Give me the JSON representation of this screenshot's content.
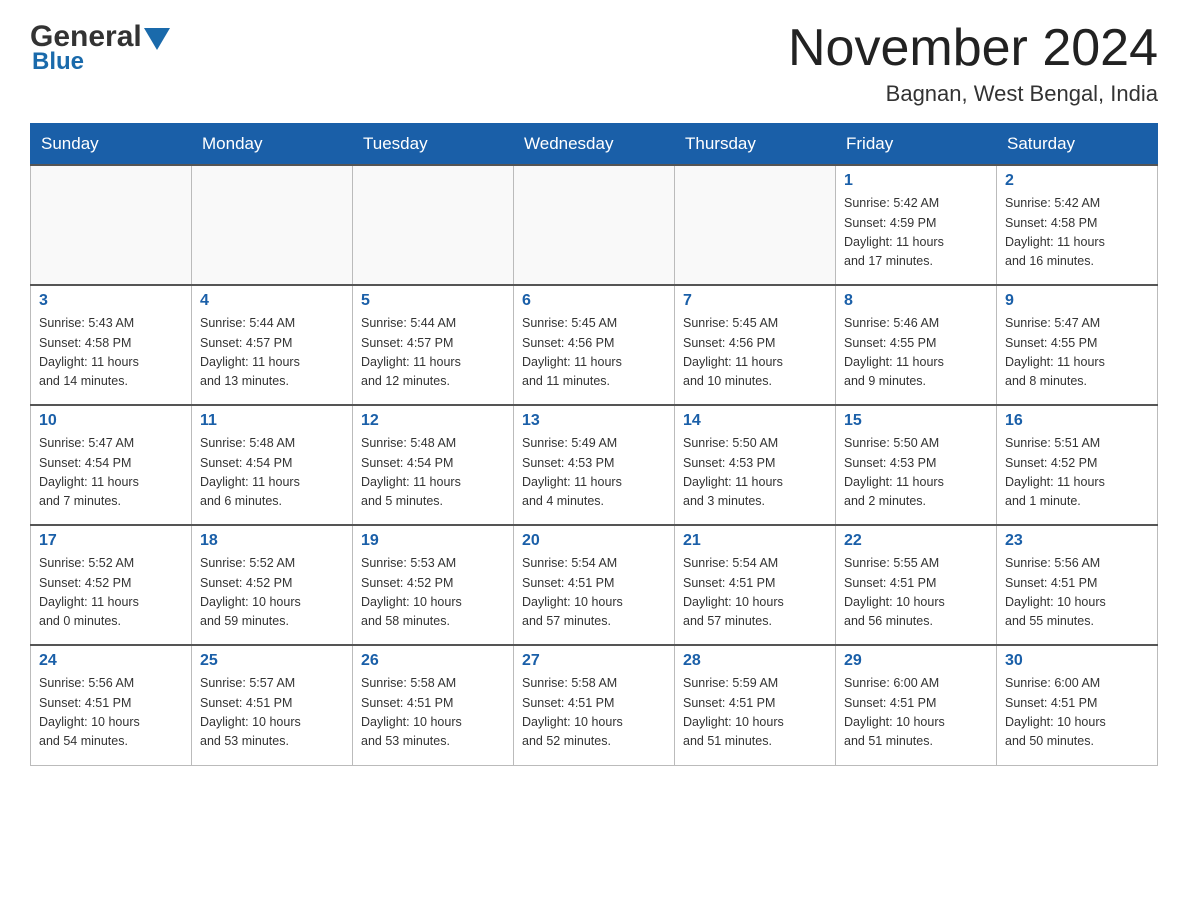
{
  "header": {
    "logo_general": "General",
    "logo_blue": "Blue",
    "month_title": "November 2024",
    "location": "Bagnan, West Bengal, India"
  },
  "weekdays": [
    "Sunday",
    "Monday",
    "Tuesday",
    "Wednesday",
    "Thursday",
    "Friday",
    "Saturday"
  ],
  "weeks": [
    {
      "days": [
        {
          "number": "",
          "info": ""
        },
        {
          "number": "",
          "info": ""
        },
        {
          "number": "",
          "info": ""
        },
        {
          "number": "",
          "info": ""
        },
        {
          "number": "",
          "info": ""
        },
        {
          "number": "1",
          "info": "Sunrise: 5:42 AM\nSunset: 4:59 PM\nDaylight: 11 hours\nand 17 minutes."
        },
        {
          "number": "2",
          "info": "Sunrise: 5:42 AM\nSunset: 4:58 PM\nDaylight: 11 hours\nand 16 minutes."
        }
      ]
    },
    {
      "days": [
        {
          "number": "3",
          "info": "Sunrise: 5:43 AM\nSunset: 4:58 PM\nDaylight: 11 hours\nand 14 minutes."
        },
        {
          "number": "4",
          "info": "Sunrise: 5:44 AM\nSunset: 4:57 PM\nDaylight: 11 hours\nand 13 minutes."
        },
        {
          "number": "5",
          "info": "Sunrise: 5:44 AM\nSunset: 4:57 PM\nDaylight: 11 hours\nand 12 minutes."
        },
        {
          "number": "6",
          "info": "Sunrise: 5:45 AM\nSunset: 4:56 PM\nDaylight: 11 hours\nand 11 minutes."
        },
        {
          "number": "7",
          "info": "Sunrise: 5:45 AM\nSunset: 4:56 PM\nDaylight: 11 hours\nand 10 minutes."
        },
        {
          "number": "8",
          "info": "Sunrise: 5:46 AM\nSunset: 4:55 PM\nDaylight: 11 hours\nand 9 minutes."
        },
        {
          "number": "9",
          "info": "Sunrise: 5:47 AM\nSunset: 4:55 PM\nDaylight: 11 hours\nand 8 minutes."
        }
      ]
    },
    {
      "days": [
        {
          "number": "10",
          "info": "Sunrise: 5:47 AM\nSunset: 4:54 PM\nDaylight: 11 hours\nand 7 minutes."
        },
        {
          "number": "11",
          "info": "Sunrise: 5:48 AM\nSunset: 4:54 PM\nDaylight: 11 hours\nand 6 minutes."
        },
        {
          "number": "12",
          "info": "Sunrise: 5:48 AM\nSunset: 4:54 PM\nDaylight: 11 hours\nand 5 minutes."
        },
        {
          "number": "13",
          "info": "Sunrise: 5:49 AM\nSunset: 4:53 PM\nDaylight: 11 hours\nand 4 minutes."
        },
        {
          "number": "14",
          "info": "Sunrise: 5:50 AM\nSunset: 4:53 PM\nDaylight: 11 hours\nand 3 minutes."
        },
        {
          "number": "15",
          "info": "Sunrise: 5:50 AM\nSunset: 4:53 PM\nDaylight: 11 hours\nand 2 minutes."
        },
        {
          "number": "16",
          "info": "Sunrise: 5:51 AM\nSunset: 4:52 PM\nDaylight: 11 hours\nand 1 minute."
        }
      ]
    },
    {
      "days": [
        {
          "number": "17",
          "info": "Sunrise: 5:52 AM\nSunset: 4:52 PM\nDaylight: 11 hours\nand 0 minutes."
        },
        {
          "number": "18",
          "info": "Sunrise: 5:52 AM\nSunset: 4:52 PM\nDaylight: 10 hours\nand 59 minutes."
        },
        {
          "number": "19",
          "info": "Sunrise: 5:53 AM\nSunset: 4:52 PM\nDaylight: 10 hours\nand 58 minutes."
        },
        {
          "number": "20",
          "info": "Sunrise: 5:54 AM\nSunset: 4:51 PM\nDaylight: 10 hours\nand 57 minutes."
        },
        {
          "number": "21",
          "info": "Sunrise: 5:54 AM\nSunset: 4:51 PM\nDaylight: 10 hours\nand 57 minutes."
        },
        {
          "number": "22",
          "info": "Sunrise: 5:55 AM\nSunset: 4:51 PM\nDaylight: 10 hours\nand 56 minutes."
        },
        {
          "number": "23",
          "info": "Sunrise: 5:56 AM\nSunset: 4:51 PM\nDaylight: 10 hours\nand 55 minutes."
        }
      ]
    },
    {
      "days": [
        {
          "number": "24",
          "info": "Sunrise: 5:56 AM\nSunset: 4:51 PM\nDaylight: 10 hours\nand 54 minutes."
        },
        {
          "number": "25",
          "info": "Sunrise: 5:57 AM\nSunset: 4:51 PM\nDaylight: 10 hours\nand 53 minutes."
        },
        {
          "number": "26",
          "info": "Sunrise: 5:58 AM\nSunset: 4:51 PM\nDaylight: 10 hours\nand 53 minutes."
        },
        {
          "number": "27",
          "info": "Sunrise: 5:58 AM\nSunset: 4:51 PM\nDaylight: 10 hours\nand 52 minutes."
        },
        {
          "number": "28",
          "info": "Sunrise: 5:59 AM\nSunset: 4:51 PM\nDaylight: 10 hours\nand 51 minutes."
        },
        {
          "number": "29",
          "info": "Sunrise: 6:00 AM\nSunset: 4:51 PM\nDaylight: 10 hours\nand 51 minutes."
        },
        {
          "number": "30",
          "info": "Sunrise: 6:00 AM\nSunset: 4:51 PM\nDaylight: 10 hours\nand 50 minutes."
        }
      ]
    }
  ]
}
